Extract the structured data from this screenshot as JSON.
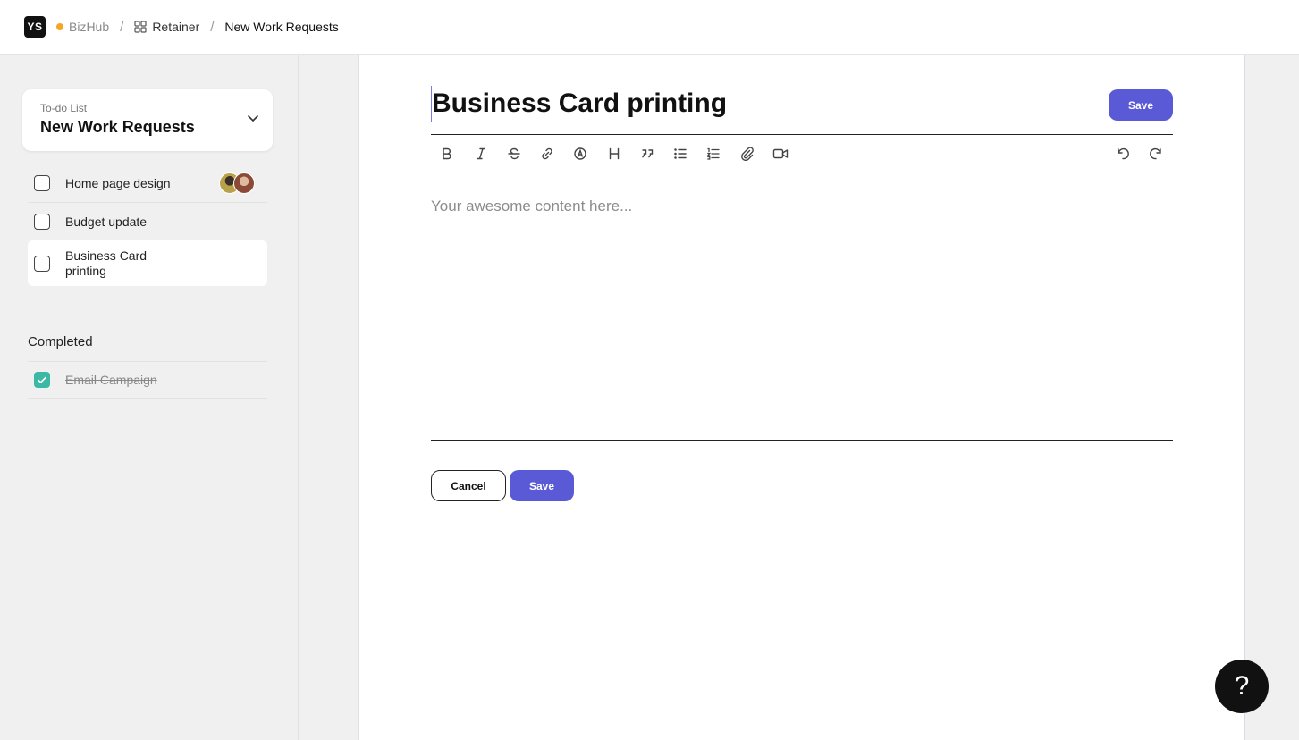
{
  "header": {
    "logo_text": "YS",
    "breadcrumbs": [
      {
        "label": "BizHub",
        "dot_color": "#f5a623"
      },
      {
        "label": "Retainer"
      },
      {
        "label": "New Work Requests"
      }
    ]
  },
  "sidebar": {
    "list_selector": {
      "label": "To-do List",
      "value": "New Work Requests"
    },
    "tasks": [
      {
        "label": "Home page design",
        "checked": false,
        "has_assignees": true
      },
      {
        "label": "Budget update",
        "checked": false
      },
      {
        "label": "Business Card printing",
        "checked": false,
        "active": true
      }
    ],
    "completed_title": "Completed",
    "completed": [
      {
        "label": "Email Campaign",
        "checked": true
      }
    ]
  },
  "editor": {
    "title": "Business Card printing",
    "save_label": "Save",
    "placeholder": "Your awesome content here...",
    "toolbar": [
      "bold-icon",
      "italic-icon",
      "strikethrough-icon",
      "link-icon",
      "mention-icon",
      "heading-icon",
      "quote-icon",
      "bullet-list-icon",
      "numbered-list-icon",
      "attachment-icon",
      "video-icon",
      "undo-icon",
      "redo-icon"
    ],
    "cancel_label": "Cancel",
    "submit_label": "Save"
  },
  "help": {
    "label": "?"
  },
  "colors": {
    "accent": "#5a5ad6",
    "check": "#3bb9a4",
    "dot": "#f5a623"
  }
}
